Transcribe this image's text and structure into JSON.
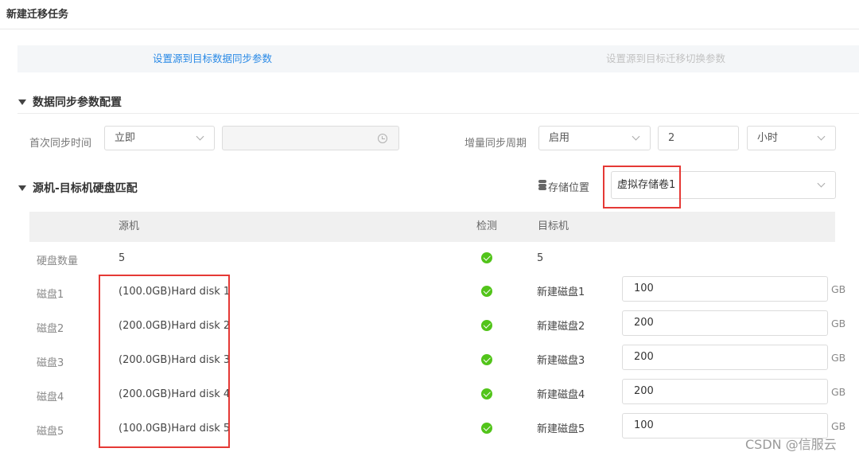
{
  "page_title": "新建迁移任务",
  "steps": [
    {
      "label": "设置源到目标数据同步参数",
      "active": true
    },
    {
      "label": "设置源到目标迁移切换参数",
      "active": false
    }
  ],
  "sync_section": {
    "title": "数据同步参数配置",
    "first_sync_label": "首次同步时间",
    "first_sync_value": "立即",
    "first_sync_time_value": "",
    "incremental_label": "增量同步周期",
    "incremental_mode": "启用",
    "incremental_interval": "2",
    "incremental_unit": "小时"
  },
  "disk_section": {
    "title": "源机-目标机硬盘匹配",
    "storage_label": "存储位置",
    "storage_value": "虚拟存储卷1",
    "columns": {
      "source": "源机",
      "check": "检测",
      "target": "目标机"
    },
    "disk_count_label": "硬盘数量",
    "source_disk_count": "5",
    "target_disk_count": "5",
    "unit": "GB",
    "rows": [
      {
        "label": "磁盘1",
        "source": "(100.0GB)Hard disk 1",
        "target_label": "新建磁盘1",
        "target_size": "100"
      },
      {
        "label": "磁盘2",
        "source": "(200.0GB)Hard disk 2",
        "target_label": "新建磁盘2",
        "target_size": "200"
      },
      {
        "label": "磁盘3",
        "source": "(200.0GB)Hard disk 3",
        "target_label": "新建磁盘3",
        "target_size": "200"
      },
      {
        "label": "磁盘4",
        "source": "(200.0GB)Hard disk 4",
        "target_label": "新建磁盘4",
        "target_size": "200"
      },
      {
        "label": "磁盘5",
        "source": "(100.0GB)Hard disk 5",
        "target_label": "新建磁盘5",
        "target_size": "100"
      }
    ]
  },
  "watermark": "CSDN @信服云",
  "colors": {
    "accent": "#2a8ae6",
    "check": "#52c41a",
    "highlight": "#e53935"
  }
}
